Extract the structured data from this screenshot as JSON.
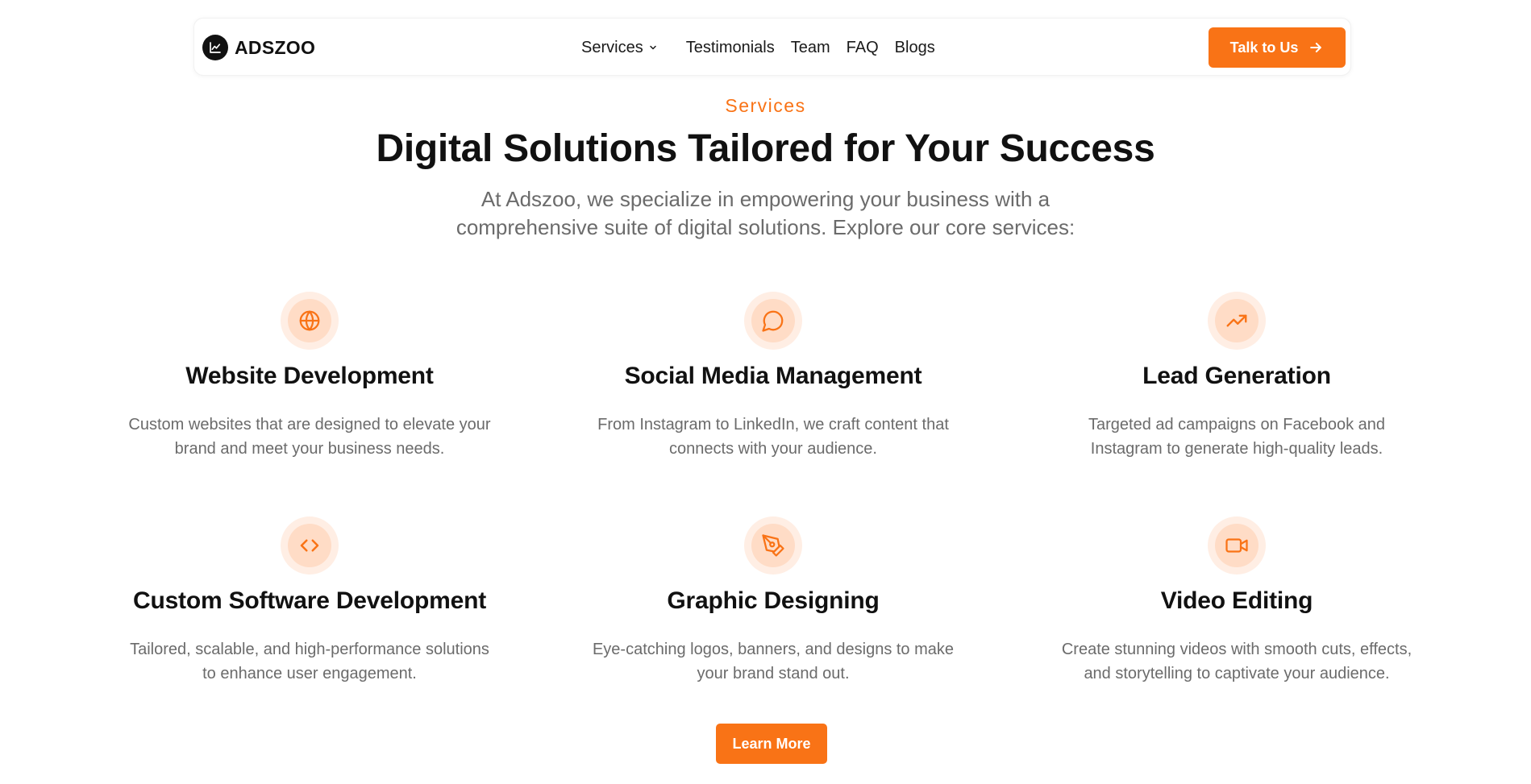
{
  "nav": {
    "brand": "ADSZOO",
    "links": {
      "services": "Services",
      "testimonials": "Testimonials",
      "team": "Team",
      "faq": "FAQ",
      "blogs": "Blogs"
    },
    "cta": "Talk to Us"
  },
  "hero": {
    "eyebrow": "Services",
    "title": "Digital Solutions Tailored for Your Success",
    "subtitle_lines": [
      "At Adszoo, we specialize in empowering your business with a",
      "comprehensive suite of digital solutions. Explore our core services:"
    ]
  },
  "services": [
    {
      "icon": "globe-icon",
      "title": "Website Development",
      "desc_lines": [
        "Custom websites that are designed to elevate your",
        "brand and meet your business needs."
      ]
    },
    {
      "icon": "chat-bubble-icon",
      "title": "Social Media Management",
      "desc_lines": [
        "From Instagram to LinkedIn, we craft content that",
        "connects with your audience."
      ]
    },
    {
      "icon": "trending-up-icon",
      "title": "Lead Generation",
      "desc_lines": [
        "Targeted ad campaigns on Facebook and",
        "Instagram to generate high-quality leads."
      ]
    },
    {
      "icon": "code-icon",
      "title": "Custom Software Development",
      "desc_lines": [
        "Tailored, scalable, and high-performance solutions",
        "to enhance user engagement."
      ]
    },
    {
      "icon": "pen-tool-icon",
      "title": "Graphic Designing",
      "desc_lines": [
        "Eye-catching logos, banners, and designs to make",
        "your brand stand out."
      ]
    },
    {
      "icon": "video-icon",
      "title": "Video Editing",
      "desc_lines": [
        "Create stunning videos with smooth cuts, effects,",
        "and storytelling to captivate your audience."
      ]
    }
  ],
  "learn_more": "Learn More",
  "colors": {
    "accent": "#f97316",
    "icon_bg_outer": "#ffeee4",
    "icon_bg_inner": "#ffdcc6",
    "text_dark": "#111111",
    "text_muted": "#6b6b6b"
  }
}
